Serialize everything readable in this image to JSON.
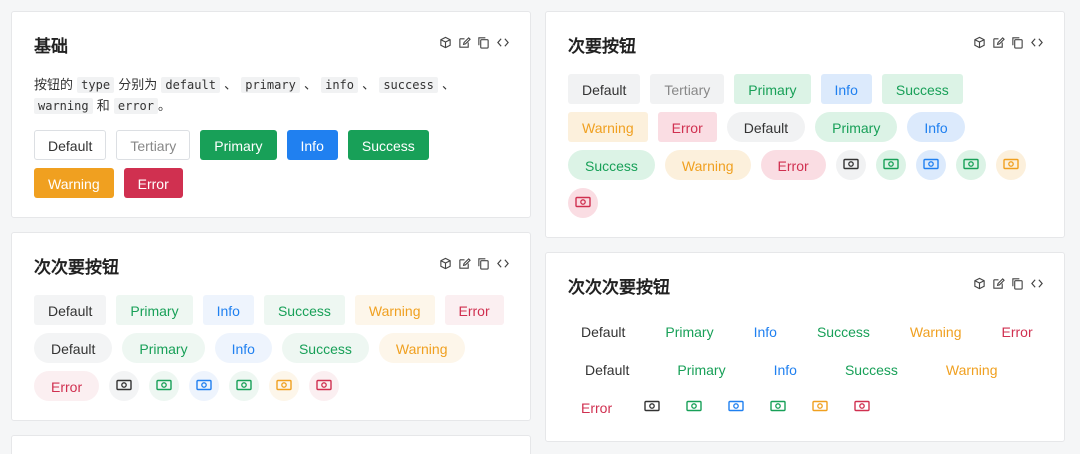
{
  "colors": {
    "default": "#333333",
    "primary": "#18a058",
    "info": "#2080f0",
    "success": "#18a058",
    "warning": "#f0a020",
    "error": "#d03050"
  },
  "tool_icons": [
    "cube-icon",
    "edit-icon",
    "copy-icon",
    "code-icon"
  ],
  "basic": {
    "title": "基础",
    "desc": {
      "p1": "按钮的",
      "c1": "type",
      "p2": "分别为",
      "c2": "default",
      "sep": "、",
      "c3": "primary",
      "c4": "info",
      "c5": "success",
      "c6": "warning",
      "p3": "和",
      "c7": "error",
      "end": "。"
    },
    "buttons": [
      "Default",
      "Tertiary",
      "Primary",
      "Info",
      "Success",
      "Warning",
      "Error"
    ]
  },
  "secondary": {
    "title": "次要按钮",
    "buttons": [
      "Default",
      "Tertiary",
      "Primary",
      "Info",
      "Success",
      "Warning",
      "Error"
    ],
    "round_buttons": [
      "Default",
      "Primary",
      "Info",
      "Success",
      "Warning",
      "Error"
    ],
    "icon_buttons": [
      "money-icon",
      "money-icon",
      "money-icon",
      "money-icon",
      "money-icon",
      "money-icon"
    ]
  },
  "tertiary": {
    "title": "次次要按钮",
    "buttons": [
      "Default",
      "Primary",
      "Info",
      "Success",
      "Warning",
      "Error"
    ],
    "round_buttons": [
      "Default",
      "Primary",
      "Info",
      "Success",
      "Warning",
      "Error"
    ],
    "icon_buttons": [
      "money-icon",
      "money-icon",
      "money-icon",
      "money-icon",
      "money-icon",
      "money-icon"
    ]
  },
  "quaternary": {
    "title": "次次次要按钮",
    "buttons": [
      "Default",
      "Primary",
      "Info",
      "Success",
      "Warning",
      "Error"
    ],
    "round_buttons": [
      "Default",
      "Primary",
      "Info",
      "Success",
      "Warning"
    ],
    "error_label": "Error",
    "icon_buttons": [
      "money-icon",
      "money-icon",
      "money-icon",
      "money-icon",
      "money-icon",
      "money-icon"
    ]
  }
}
